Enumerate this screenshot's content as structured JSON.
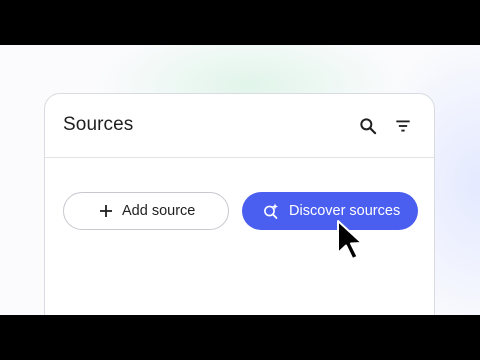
{
  "panel": {
    "title": "Sources",
    "header_icons": [
      "search-icon",
      "filter-icon"
    ]
  },
  "actions": {
    "add_source": {
      "label": "Add source",
      "icon": "plus-icon"
    },
    "discover_sources": {
      "label": "Discover sources",
      "icon": "sparkle-search-icon"
    }
  },
  "colors": {
    "accent": "#4a5ef0",
    "border": "#d8dbe0",
    "text": "#1f1f1f",
    "cursor": "#000000"
  }
}
